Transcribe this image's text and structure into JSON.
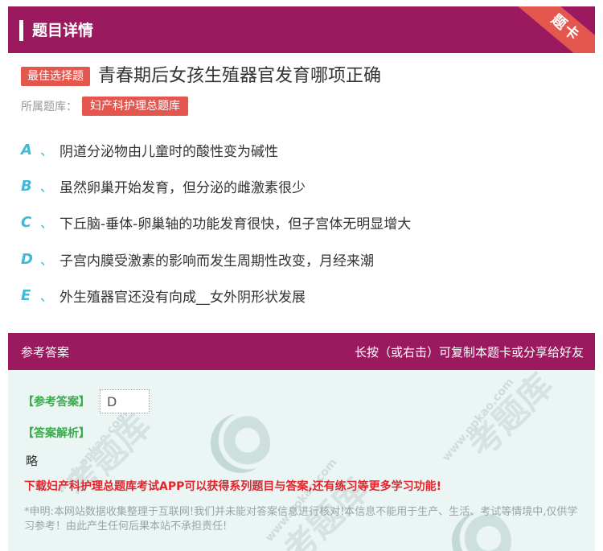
{
  "header": {
    "title": "题目详情",
    "corner_tag": "题卡"
  },
  "question": {
    "type_badge": "最佳选择题",
    "title": "青春期后女孩生殖器官发育哪项正确",
    "library_label": "所属题库：",
    "library_name": "妇产科护理总题库"
  },
  "options": [
    {
      "letter": "A",
      "sep": "、",
      "text": "阴道分泌物由儿童时的酸性变为碱性"
    },
    {
      "letter": "B",
      "sep": "、",
      "text": "虽然卵巢开始发育，但分泌的雌激素很少"
    },
    {
      "letter": "C",
      "sep": "、",
      "text": "下丘脑-垂体-卵巢轴的功能发育很快，但子宫体无明显增大"
    },
    {
      "letter": "D",
      "sep": "、",
      "text": "子宫内膜受激素的影响而发生周期性改变，月经来潮"
    },
    {
      "letter": "E",
      "sep": "、",
      "text": "外生殖器官还没有向成__女外阴形状发展"
    }
  ],
  "answer": {
    "section_title": "参考答案",
    "share_hint": "长按（或右击）可复制本题卡或分享给好友",
    "answer_label": "【参考答案】",
    "answer_value": "D",
    "analysis_label": "【答案解析】",
    "analysis_text": "略",
    "download_text": "下载妇产科护理总题库考试APP可以获得系列题目与答案,还有练习等更多学习功能!",
    "disclaimer": "*申明:本网站数据收集整理于互联网!我们并未能对答案信息进行核对!本信息不能用于生产、生活、考试等情境中,仅供学习参考！由此产生任何后果本站不承担责任!"
  },
  "watermark": {
    "site": "www.ppkao.com"
  },
  "colors": {
    "brand": "#9b1a5f",
    "accent": "#e4574f",
    "option_letter": "#3fb8d9",
    "answer_label": "#3aaa4c",
    "download": "#e3242b"
  }
}
